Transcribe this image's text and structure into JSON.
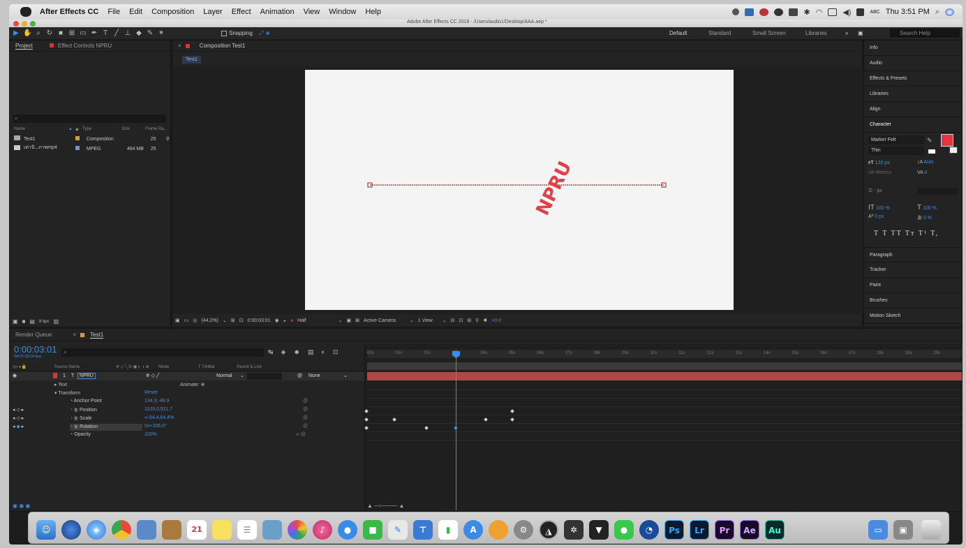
{
  "menubar": {
    "app": "After Effects CC",
    "items": [
      "File",
      "Edit",
      "Composition",
      "Layer",
      "Effect",
      "Animation",
      "View",
      "Window",
      "Help"
    ],
    "window_title": "Adobe After Effects CC 2018 - /Users/audio1/Desktop/AAA.aep *",
    "input_source": "ABC",
    "clock": "Thu 3:51 PM"
  },
  "toolbar": {
    "snapping_label": "Snapping",
    "workspaces": [
      "Default",
      "Standard",
      "Small Screen",
      "Libraries"
    ],
    "search_placeholder": "Search Help"
  },
  "project_panel": {
    "tabs": [
      "Project",
      "Effect Controls NPRU"
    ],
    "columns": [
      "Name",
      "Type",
      "Size",
      "Frame Ra..."
    ],
    "items": [
      {
        "name": "Test1",
        "type": "Composition",
        "size": "",
        "fps": "25"
      },
      {
        "name": "เต่าปั...ภาพmp4",
        "type": "MPEG",
        "size": "464 MB",
        "fps": "25"
      }
    ],
    "bpc": "8 bpc"
  },
  "comp_panel": {
    "tab": "Composition Test1",
    "subtab": "Test1",
    "canvas_text": "NPRU",
    "zoom": "(44.2%)",
    "timecode": "0:00:03:01",
    "resolution": "Half",
    "camera": "Active Camera",
    "views": "1 View",
    "exposure": "+0.0"
  },
  "right_panel": {
    "items": [
      "Info",
      "Audio",
      "Effects & Presets",
      "Libraries",
      "Align",
      "Character"
    ],
    "font_name": "Marker Felt",
    "font_style": "Thin",
    "font_size": "120 px",
    "leading": "Auto",
    "kerning": "Metrics",
    "tracking": "0",
    "stroke_width": "- px",
    "vscale": "100 %",
    "hscale": "100 %",
    "baseline": "0 px",
    "tsume": "0 %",
    "type_styles": "T  T  TT  Tт  T¹  T,",
    "bottom_items": [
      "Paragraph",
      "Tracker",
      "Paint",
      "Brushes",
      "Motion Sketch"
    ],
    "fill_color": "#e8353b"
  },
  "timeline": {
    "tabs": [
      "Render Queue",
      "Test1"
    ],
    "timecode": "0:00:03:01",
    "frame_info": "00076 (25.00 fps)",
    "columns": [
      "Source Name",
      "Mode",
      "T TrkMat",
      "Parent & Link"
    ],
    "layer": {
      "index": "1",
      "name": "NPRU",
      "mode": "Normal",
      "parent": "None"
    },
    "text_label": "Text",
    "animate_label": "Animate:",
    "transform_label": "Transform",
    "reset_label": "Reset",
    "properties": [
      {
        "name": "Anchor Point",
        "value": "134.3,-48.9"
      },
      {
        "name": "Position",
        "value": "1103.0,511.7"
      },
      {
        "name": "Scale",
        "value": "∞ 64.4,64.4%"
      },
      {
        "name": "Rotation",
        "value": "0x+206.0°"
      },
      {
        "name": "Opacity",
        "value": "100%"
      }
    ],
    "ruler": [
      "00s",
      "01s",
      "02s",
      "03s",
      "04s",
      "05s",
      "06s",
      "07s",
      "08s",
      "09s",
      "10s",
      "11s",
      "12s",
      "13s",
      "14s",
      "15s",
      "16s",
      "17s",
      "18s",
      "19s",
      "20s"
    ]
  },
  "dock": {
    "calendar_day": "21",
    "apps": [
      "Ps",
      "Lr",
      "Pr",
      "Ae",
      "Au"
    ]
  }
}
